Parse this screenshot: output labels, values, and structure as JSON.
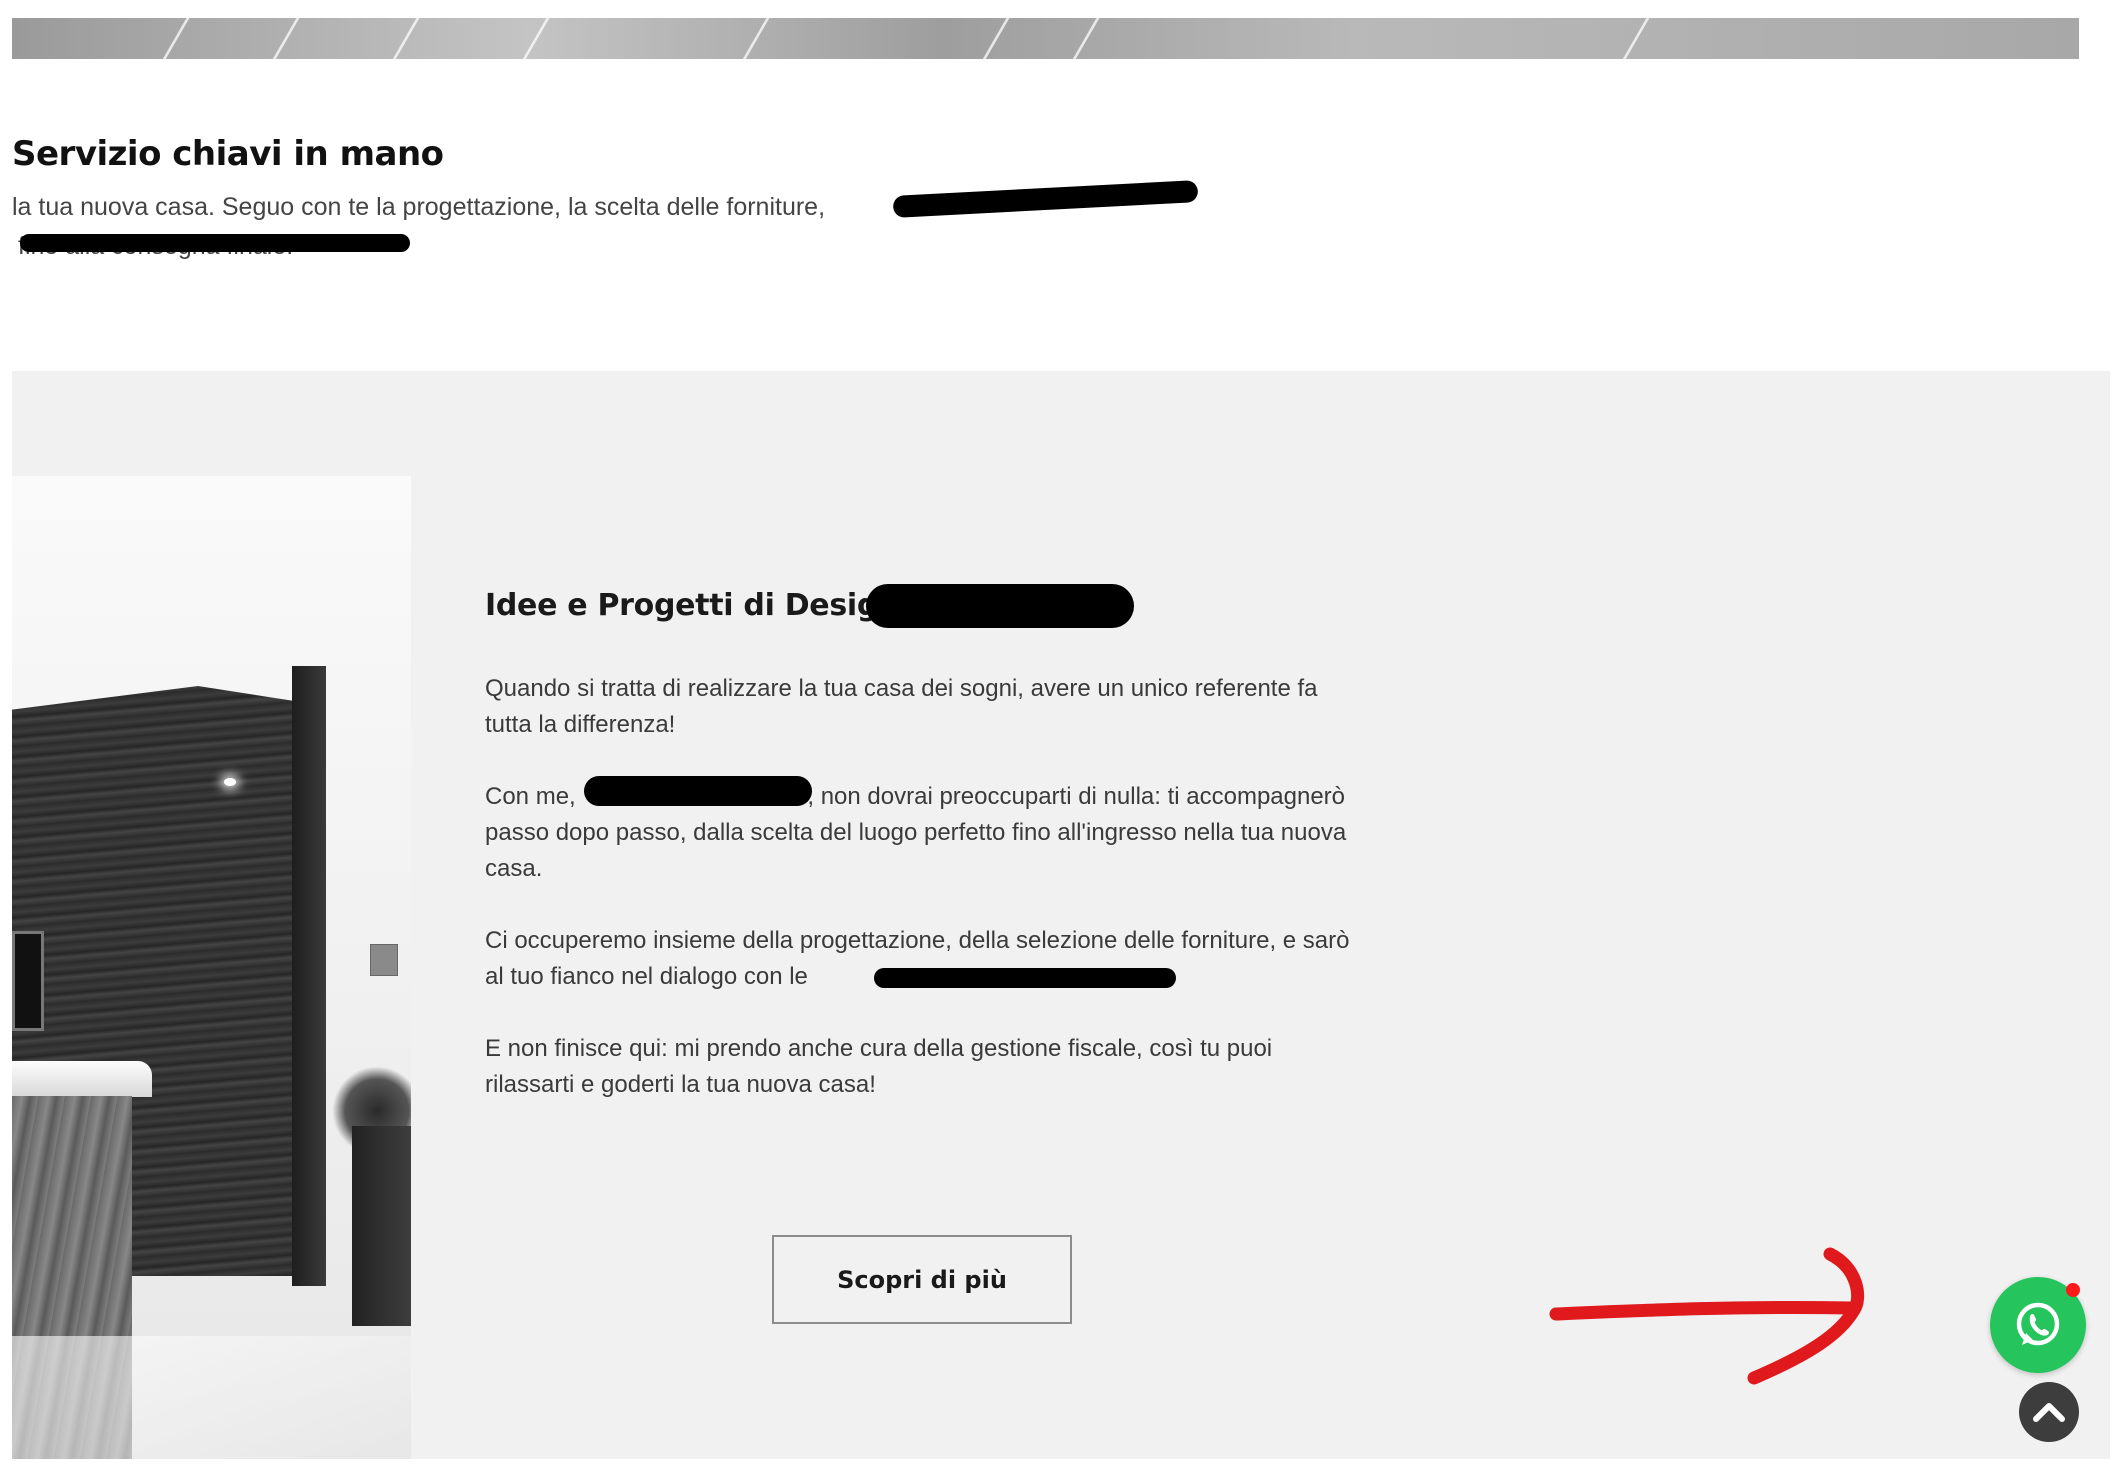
{
  "section_turnkey": {
    "title": "Servizio chiavi in mano",
    "text_line1": "la tua nuova casa. Seguo con te la progettazione, la scelta delle forniture,",
    "text_line2": "fino alla consegna finale."
  },
  "section_design": {
    "title": "Idee e Progetti di Design",
    "paragraphs": {
      "p1": "Quando si tratta di realizzare la tua casa dei sogni, avere un unico referente fa tutta la differenza!",
      "p2_start": "Con me,",
      "p2_end": ", non dovrai preoccuparti di nulla: ti accompagnerò passo dopo passo, dalla scelta del luogo perfetto fino all'ingresso nella tua nuova casa.",
      "p3_start": "Ci occuperemo insieme della progettazione, della selezione delle forniture, e sarò al tuo fianco nel dialogo con le",
      "p4": "E non finisce qui: mi prendo anche cura della gestione fiscale, così tu puoi rilassarti e goderti la tua nuova casa!"
    },
    "cta_label": "Scopri di più"
  },
  "floating": {
    "whatsapp_icon": "whatsapp-icon",
    "scroll_top_icon": "chevron-up-icon"
  },
  "colors": {
    "whatsapp_green": "#25c45d",
    "notification_red": "#ff1a1a",
    "annotation_red": "#e0191c",
    "section_gray": "#f1f1f1"
  }
}
